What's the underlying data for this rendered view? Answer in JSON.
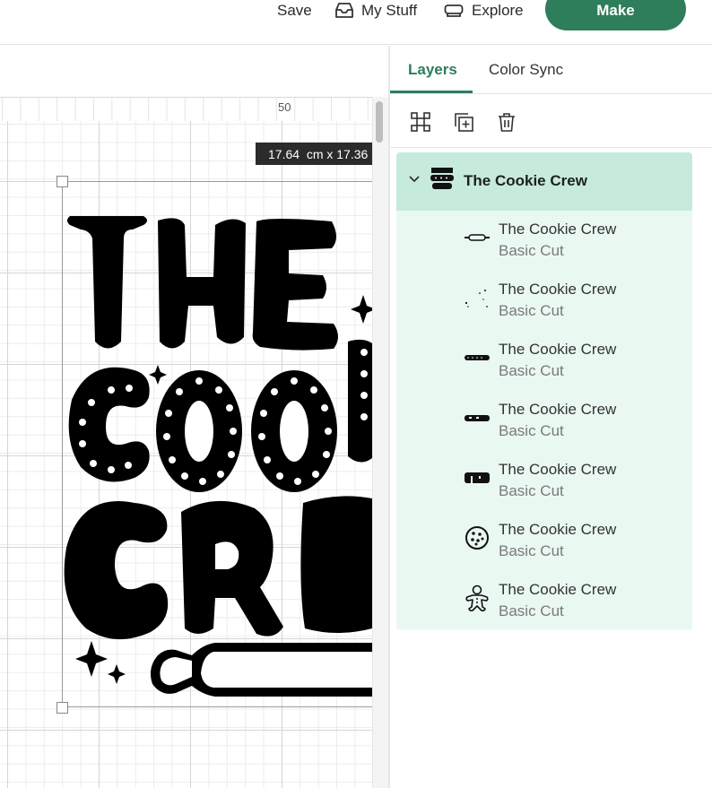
{
  "topbar": {
    "save_label": "Save",
    "mystuff_label": "My Stuff",
    "explore_label": "Explore",
    "make_label": "Make",
    "accent_color": "#2e7d5b"
  },
  "canvas": {
    "ruler_mark": "50",
    "dimension_tooltip": "17.64  cm x 17.36",
    "design_text_lines": [
      "THE",
      "COOKIE",
      "CREW"
    ]
  },
  "panel": {
    "tabs": [
      {
        "label": "Layers",
        "active": true
      },
      {
        "label": "Color Sync",
        "active": false
      }
    ],
    "tools": [
      {
        "icon": "group-icon"
      },
      {
        "icon": "duplicate-icon"
      },
      {
        "icon": "delete-icon"
      }
    ],
    "group": {
      "name": "The Cookie Crew",
      "expanded": true,
      "highlight_color": "#c6ebdc"
    },
    "layers": [
      {
        "name": "The Cookie Crew",
        "type": "Basic Cut",
        "thumb": "rolling-pin-icon"
      },
      {
        "name": "The Cookie Crew",
        "type": "Basic Cut",
        "thumb": "sparkles-icon"
      },
      {
        "name": "The Cookie Crew",
        "type": "Basic Cut",
        "thumb": "cookie-word-icon"
      },
      {
        "name": "The Cookie Crew",
        "type": "Basic Cut",
        "thumb": "crew-word-icon"
      },
      {
        "name": "The Cookie Crew",
        "type": "Basic Cut",
        "thumb": "the-word-icon"
      },
      {
        "name": "The Cookie Crew",
        "type": "Basic Cut",
        "thumb": "cookie-icon"
      },
      {
        "name": "The Cookie Crew",
        "type": "Basic Cut",
        "thumb": "gingerbread-man-icon"
      }
    ]
  }
}
